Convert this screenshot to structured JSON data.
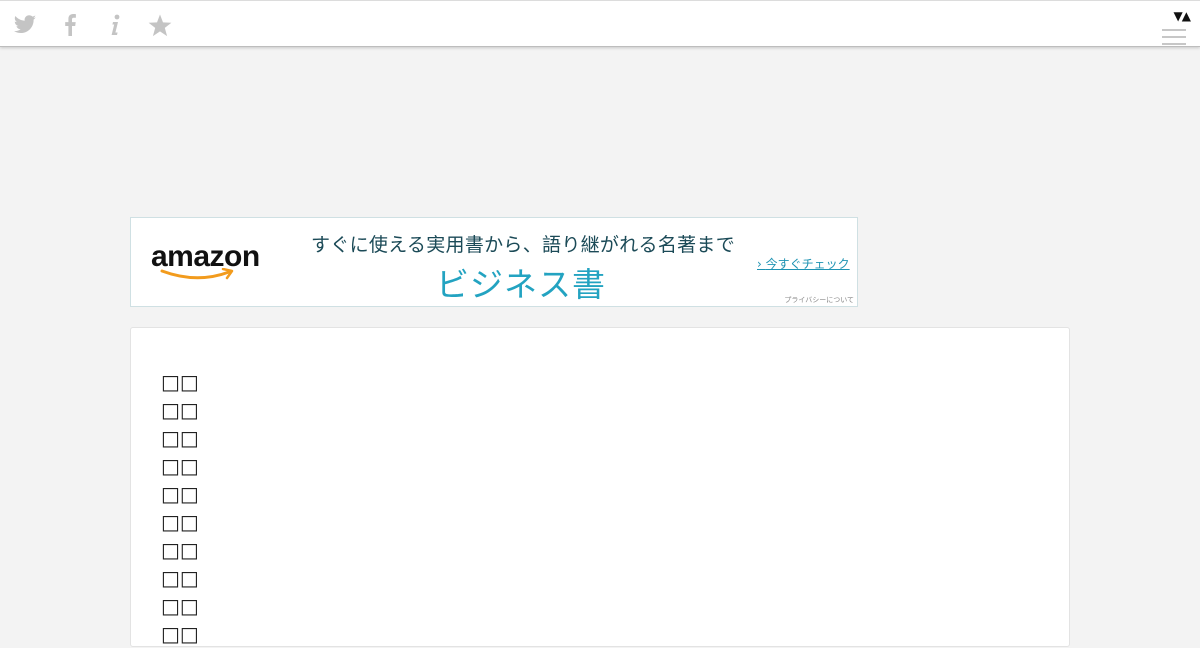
{
  "topbar": {
    "icons": [
      "twitter-icon",
      "facebook-icon",
      "info-icon",
      "star-icon"
    ],
    "toggle_label": "▼▲",
    "menu_icon": "hamburger-menu-icon"
  },
  "ad": {
    "brand": "amazon",
    "tagline": "すぐに使える実用書から、語り継がれる名著まで",
    "category": "ビジネス書",
    "cta": "今すぐチェック",
    "privacy": "プライバシーについて",
    "colors": {
      "tagline": "#1b4a57",
      "category": "#23a3c1",
      "smile": "#f29b1d"
    }
  },
  "content": {
    "lines": [
      "□□",
      "□□",
      "□□",
      "□□",
      "□□",
      "□□",
      "□□",
      "□□",
      "□□",
      "□□"
    ]
  }
}
